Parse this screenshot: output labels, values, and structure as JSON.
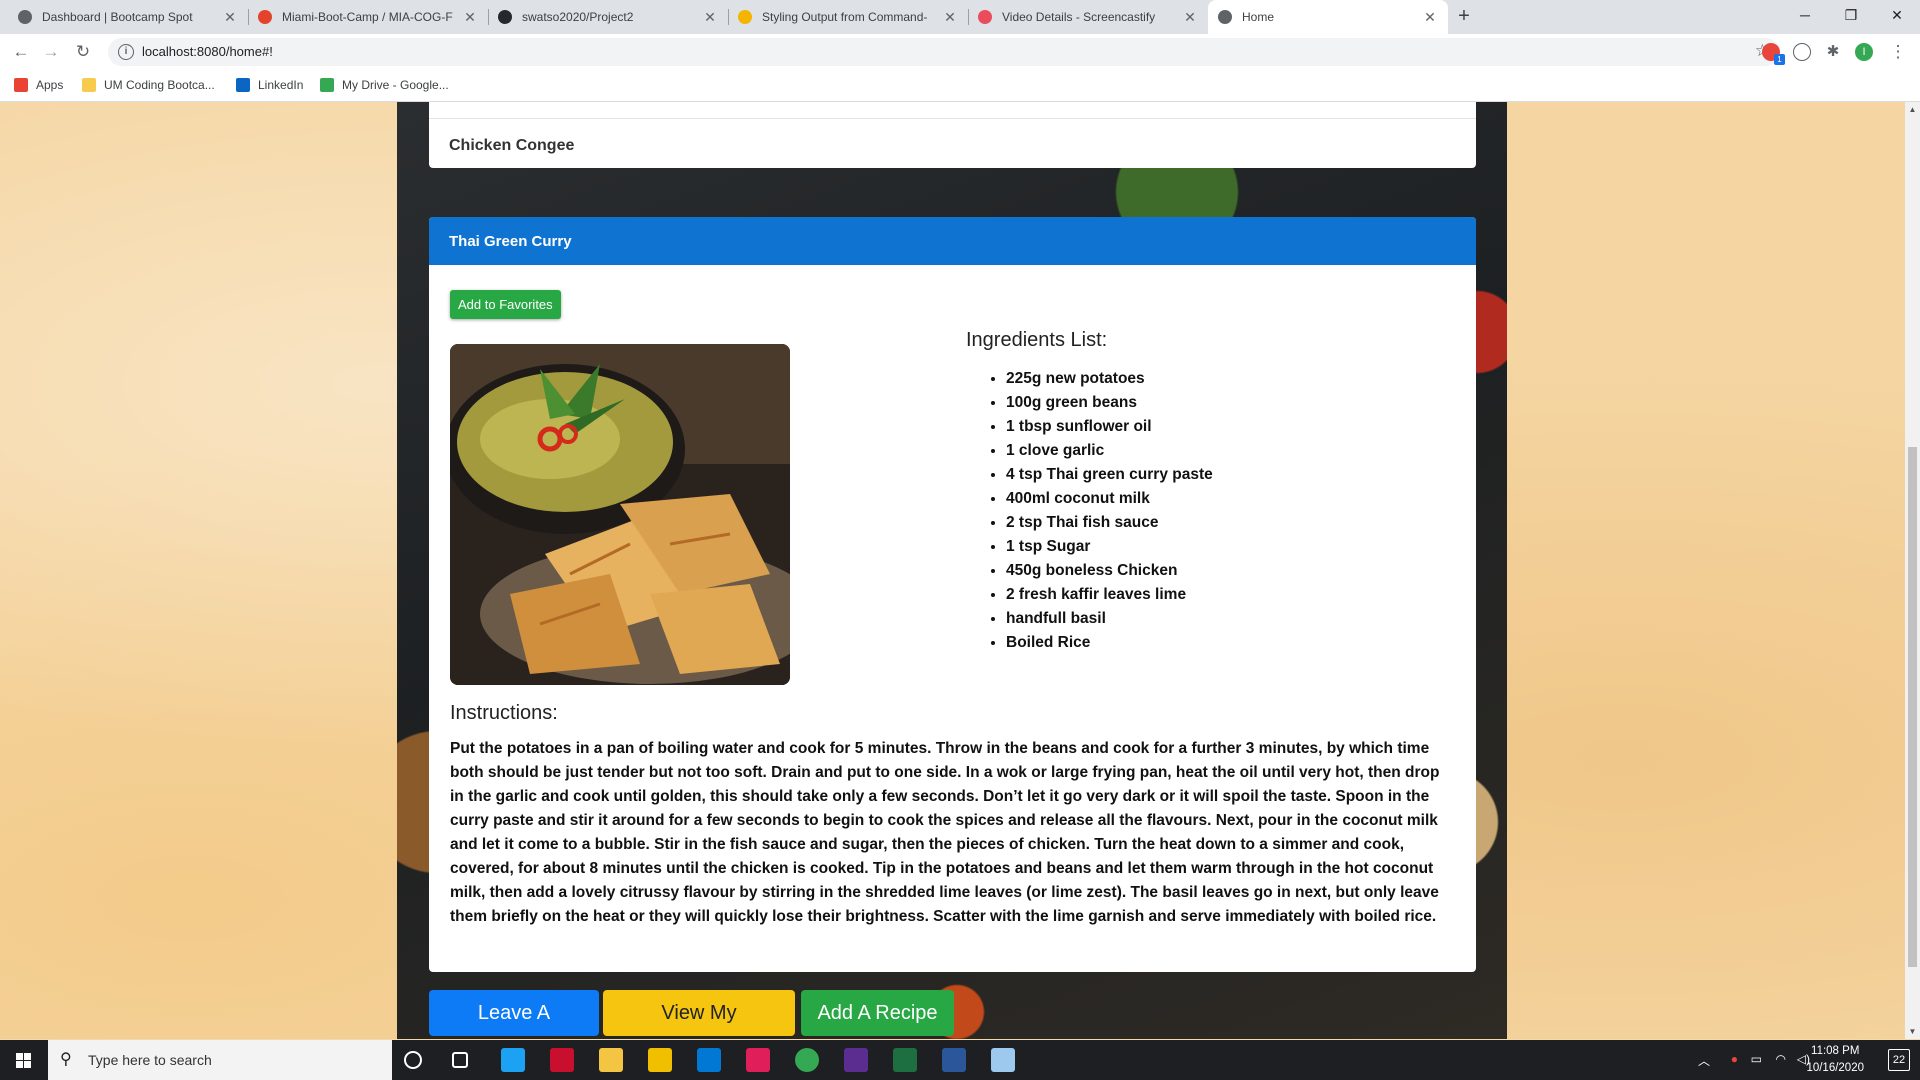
{
  "browser": {
    "tabs": [
      {
        "title": "Dashboard | Bootcamp Spot",
        "favicon_color": "#5f6368"
      },
      {
        "title": "Miami-Boot-Camp / MIA-COG-F",
        "favicon_color": "#e2432a"
      },
      {
        "title": "swatso2020/Project2",
        "favicon_color": "#24292e"
      },
      {
        "title": "Styling Output from Command-",
        "favicon_color": "#f4b400"
      },
      {
        "title": "Video Details - Screencastify",
        "favicon_color": "#ea4c5c"
      },
      {
        "title": "Home",
        "favicon_color": "#5f6368"
      }
    ],
    "active_tab": 5,
    "new_tab_symbol": "+",
    "window_controls": {
      "minimize": "─",
      "maximize": "❐",
      "close": "✕"
    },
    "url": "localhost:8080/home#!",
    "profile_initial": "I",
    "extension_badge": "1",
    "bookmarks": [
      {
        "label": "Apps",
        "icon": "apps-grid-icon"
      },
      {
        "label": "UM Coding Bootca...",
        "icon": "folder-icon"
      },
      {
        "label": "LinkedIn",
        "icon": "linkedin-icon"
      },
      {
        "label": "My Drive - Google...",
        "icon": "google-drive-icon"
      }
    ]
  },
  "page": {
    "previous_recipe": {
      "title": "Chicken Congee"
    },
    "recipe": {
      "title": "Thai Green Curry",
      "favorite_button": "Add to Favorites",
      "image_alt": "Thai green curry with roti",
      "ingredients_heading": "Ingredients List:",
      "ingredients": [
        "225g new potatoes",
        "100g green beans",
        "1 tbsp sunflower oil",
        "1 clove garlic",
        "4 tsp Thai green curry paste",
        "400ml coconut milk",
        "2 tsp Thai fish sauce",
        "1 tsp Sugar",
        "450g boneless Chicken",
        "2 fresh kaffir leaves lime",
        "handfull basil",
        "Boiled Rice"
      ],
      "instructions_heading": "Instructions:",
      "instructions": "Put the potatoes in a pan of boiling water and cook for 5 minutes. Throw in the beans and cook for a further 3 minutes, by which time both should be just tender but not too soft. Drain and put to one side. In a wok or large frying pan, heat the oil until very hot, then drop in the garlic and cook until golden, this should take only a few seconds. Don’t let it go very dark or it will spoil the taste. Spoon in the curry paste and stir it around for a few seconds to begin to cook the spices and release all the flavours. Next, pour in the coconut milk and let it come to a bubble. Stir in the fish sauce and sugar, then the pieces of chicken. Turn the heat down to a simmer and cook, covered, for about 8 minutes until the chicken is cooked. Tip in the potatoes and beans and let them warm through in the hot coconut milk, then add a lovely citrussy flavour by stirring in the shredded lime leaves (or lime zest). The basil leaves go in next, but only leave them briefly on the heat or they will quickly lose their brightness. Scatter with the lime garnish and serve immediately with boiled rice."
    },
    "actions": {
      "leave_review": "Leave A Review",
      "view_favorites": "View My Favorites",
      "add_recipe": "Add A Recipe"
    },
    "colors": {
      "header_blue": "#0f73d1",
      "success_green": "#28a745",
      "warning_yellow": "#f6c50f",
      "primary_blue": "#0d7bf6"
    }
  },
  "taskbar": {
    "search_placeholder": "Type here to search",
    "pinned_apps": [
      {
        "name": "task-view-icon",
        "color": "#ffffff"
      },
      {
        "name": "lumio-icon",
        "color": "#1da1f2"
      },
      {
        "name": "mcafee-icon",
        "color": "#c8102e"
      },
      {
        "name": "file-explorer-icon",
        "color": "#f4c542"
      },
      {
        "name": "git-icon",
        "color": "#f0c000"
      },
      {
        "name": "vscode-icon",
        "color": "#0078d4"
      },
      {
        "name": "slack-icon",
        "color": "#e01e5a"
      },
      {
        "name": "chrome-icon",
        "color": "#34a853"
      },
      {
        "name": "visual-studio-icon",
        "color": "#5c2d91"
      },
      {
        "name": "excel-icon",
        "color": "#1d6f42"
      },
      {
        "name": "word-icon",
        "color": "#2b579a"
      },
      {
        "name": "snip-icon",
        "color": "#9ec9ef"
      }
    ],
    "time": "11:08 PM",
    "date": "10/16/2020",
    "notification_count": "22"
  }
}
